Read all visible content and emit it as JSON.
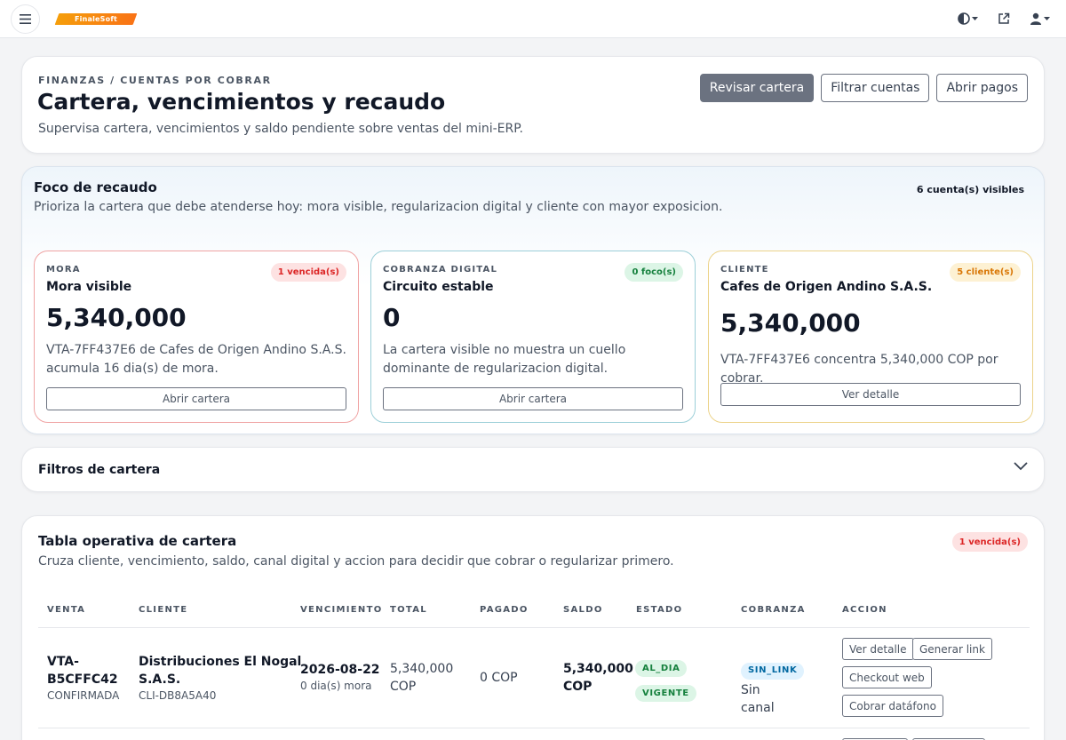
{
  "brand": {
    "logo_text": "FinaleSoft"
  },
  "header": {
    "eyebrow": "FINANZAS / CUENTAS POR COBRAR",
    "title": "Cartera, vencimientos y recaudo",
    "subtitle": "Supervisa cartera, vencimientos y saldo pendiente sobre ventas del mini-ERP.",
    "buttons": {
      "review": "Revisar cartera",
      "filter": "Filtrar cuentas",
      "payments": "Abrir pagos"
    }
  },
  "focus": {
    "title": "Foco de recaudo",
    "subtitle": "Prioriza la cartera que debe atenderse hoy: mora visible, regularizacion digital y cliente con mayor exposicion.",
    "count": "6 cuenta(s) visibles",
    "cards": [
      {
        "eyebrow": "MORA",
        "title": "Mora visible",
        "badge": "1 vencida(s)",
        "value": "5,340,000",
        "desc": "VTA-7FF437E6 de Cafes de Origen Andino S.A.S. acumula 16 dia(s) de mora.",
        "button": "Abrir cartera"
      },
      {
        "eyebrow": "COBRANZA DIGITAL",
        "title": "Circuito estable",
        "badge": "0 foco(s)",
        "value": "0",
        "desc": "La cartera visible no muestra un cuello dominante de regularizacion digital.",
        "button": "Abrir cartera"
      },
      {
        "eyebrow": "CLIENTE",
        "title": "Cafes de Origen Andino S.A.S.",
        "badge": "5 cliente(s)",
        "value": "5,340,000",
        "desc": "VTA-7FF437E6 concentra 5,340,000 COP por cobrar.",
        "button": "Ver detalle"
      }
    ]
  },
  "filters": {
    "title": "Filtros de cartera"
  },
  "table": {
    "title": "Tabla operativa de cartera",
    "subtitle": "Cruza cliente, vencimiento, saldo, canal digital y accion para decidir que cobrar o regularizar primero.",
    "badge": "1 vencida(s)",
    "columns": [
      "VENTA",
      "CLIENTE",
      "VENCIMIENTO",
      "TOTAL",
      "PAGADO",
      "SALDO",
      "ESTADO",
      "COBRANZA",
      "ACCION"
    ],
    "rows": [
      {
        "sale_id_1": "VTA-",
        "sale_id_2": "B5CFFC42",
        "sale_status": "CONFIRMADA",
        "client_1": "Distribuciones El Nogal",
        "client_2": "S.A.S.",
        "client_code": "CLI-DB8A5A40",
        "due_date": "2026-08-22",
        "due_note": "0 dia(s) mora",
        "total_1": "5,340,000",
        "total_2": "COP",
        "paid": "0 COP",
        "balance_1": "5,340,000",
        "balance_2": "COP",
        "status_1": "AL_DIA",
        "status_2": "VIGENTE",
        "collection_pill": "SIN_LINK",
        "collection_text_1": "Sin",
        "collection_text_2": "canal",
        "actions": {
          "detail": "Ver detalle",
          "link": "Generar link",
          "checkout": "Checkout web",
          "dataphone": "Cobrar datáfono"
        }
      }
    ]
  }
}
